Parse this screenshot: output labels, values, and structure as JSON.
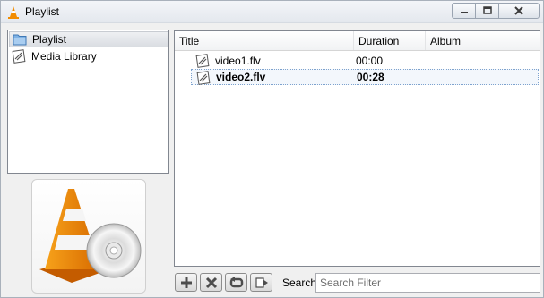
{
  "window": {
    "title": "Playlist"
  },
  "sidebar": {
    "items": [
      {
        "label": "Playlist",
        "icon": "folder-icon",
        "selected": true
      },
      {
        "label": "Media Library",
        "icon": "media-file-icon",
        "selected": false
      }
    ]
  },
  "playlist": {
    "columns": [
      "Title",
      "Duration",
      "Album"
    ],
    "rows": [
      {
        "title": "video1.flv",
        "duration": "00:00",
        "album": "",
        "playing": false
      },
      {
        "title": "video2.flv",
        "duration": "00:28",
        "album": "",
        "playing": true
      }
    ]
  },
  "toolbar": {
    "add_icon": "plus-icon",
    "remove_icon": "x-icon",
    "loop_icon": "repeat-icon",
    "clear_icon": "media-arrow-icon"
  },
  "search": {
    "label": "Search",
    "placeholder": "Search Filter",
    "value": ""
  },
  "colors": {
    "vlc_orange": "#f28c00",
    "selection_border": "#7da2ce"
  }
}
